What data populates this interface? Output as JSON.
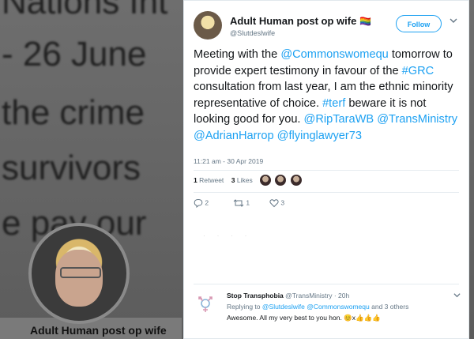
{
  "background": {
    "lines": [
      "Nations Int",
      "- 26 June",
      "the crime",
      "survivors",
      "e pay our"
    ],
    "profile_name": "Adult Human post op wife"
  },
  "tweet": {
    "author_name": "Adult Human post op wife",
    "author_flag": "🏳️‍🌈",
    "author_handle": "@Slutdeslwife",
    "follow_label": "Follow",
    "text_parts": [
      {
        "t": "Meeting with the ",
        "link": false
      },
      {
        "t": "@Commonswomequ",
        "link": true
      },
      {
        "t": " tomorrow to provide expert testimony in favour of the ",
        "link": false
      },
      {
        "t": "#GRC",
        "link": true
      },
      {
        "t": " consultation from last year, I am the ethnic minority representative of choice.  ",
        "link": false
      },
      {
        "t": "#terf",
        "link": true
      },
      {
        "t": " beware it is not looking good for you. ",
        "link": false
      },
      {
        "t": "@RipTaraWB",
        "link": true
      },
      {
        "t": " ",
        "link": false
      },
      {
        "t": "@TransMinistry",
        "link": true
      },
      {
        "t": " ",
        "link": false
      },
      {
        "t": "@AdrianHarrop",
        "link": true
      },
      {
        "t": " ",
        "link": false
      },
      {
        "t": "@flyinglawyer73",
        "link": true
      }
    ],
    "timestamp": "11:21 am - 30 Apr 2019",
    "retweet_count": "1",
    "retweet_label": "Retweet",
    "like_count": "3",
    "like_label": "Likes",
    "action_reply_count": "2",
    "action_retweet_count": "1",
    "action_like_count": "3"
  },
  "reply": {
    "author_name": "Stop Transphobia",
    "author_handle": "@TransMinistry",
    "age": "· 20h",
    "replying_prefix": "Replying to ",
    "replying_to_1": "@Slutdeslwife",
    "replying_to_2": "@Commonswomequ",
    "replying_suffix": " and 3 others",
    "text": "Awesome. All my very best to you hon. 😊x👍👍👍"
  },
  "colors": {
    "link": "#1da1f2",
    "text": "#14171a",
    "muted": "#657786"
  }
}
